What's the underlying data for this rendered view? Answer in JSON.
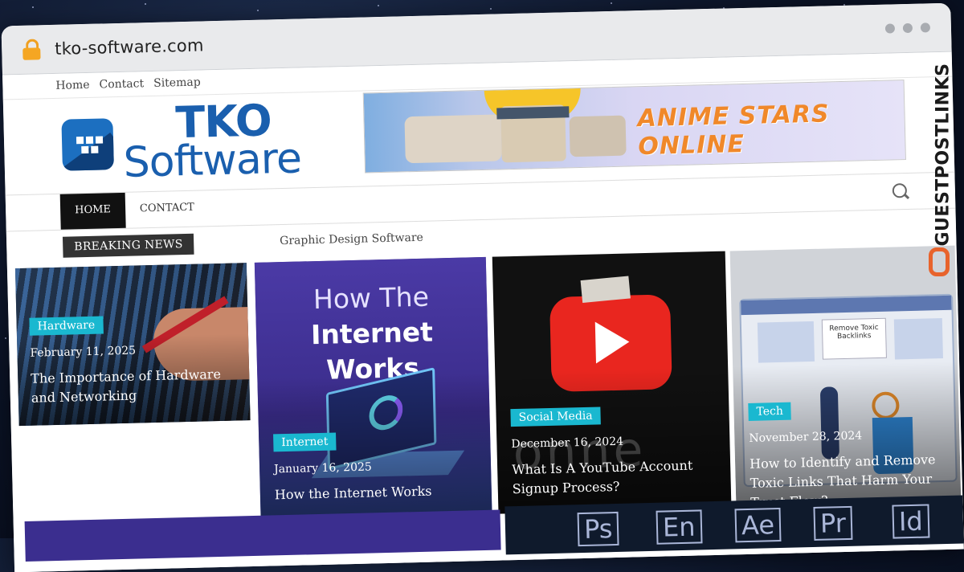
{
  "browser": {
    "url": "tko-software.com"
  },
  "top_nav": [
    "Home",
    "Contact",
    "Sitemap"
  ],
  "logo": {
    "line1": "TKO",
    "line2": "Software"
  },
  "banner": {
    "text": "ANIME STARS ONLINE"
  },
  "main_nav": {
    "items": [
      {
        "label": "HOME",
        "active": true
      },
      {
        "label": "CONTACT",
        "active": false
      }
    ]
  },
  "breaking": {
    "label": "BREAKING NEWS",
    "headline": "Graphic Design Software"
  },
  "cards": [
    {
      "category": "Hardware",
      "date": "February 11, 2025",
      "title": "The Importance of Hardware and Networking"
    },
    {
      "category": "Internet",
      "date": "January 16, 2025",
      "title": "How the Internet Works",
      "image_text_1": "How The",
      "image_text_2": "Internet Works"
    },
    {
      "category": "Social Media",
      "date": "December 16, 2024",
      "title": "What Is A YouTube Account Signup Process?"
    },
    {
      "category": "Tech",
      "date": "November 28, 2024",
      "title": "How to Identify and Remove Toxic Links That Harm Your Trust Flow?",
      "image_text": "Remove Toxic Backlinks"
    }
  ],
  "bottom_icons": [
    "Ps",
    "En",
    "Ae",
    "Pr",
    "Id"
  ],
  "watermark": "GUESTPOSTLINKS",
  "colors": {
    "accent": "#1ab8d0",
    "logo_blue": "#1a5fae",
    "banner_orange": "#f0882a",
    "watermark_chain": "#e8632c"
  }
}
